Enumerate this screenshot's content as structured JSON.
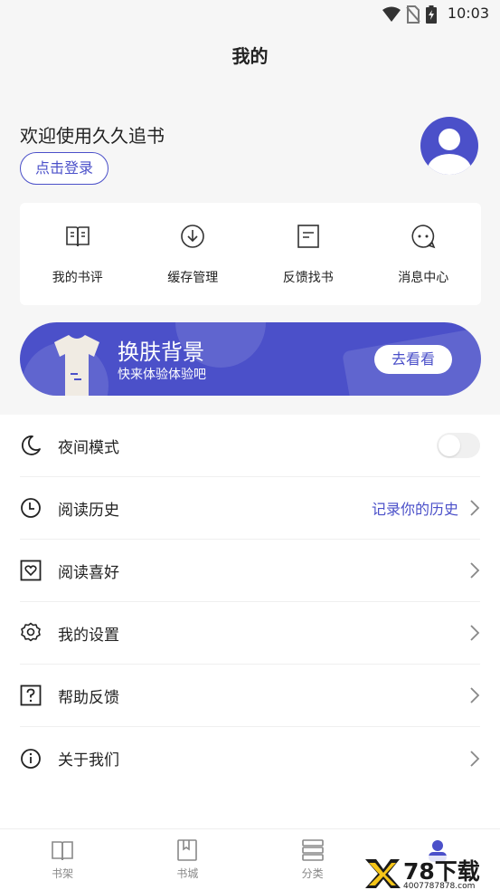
{
  "status": {
    "time": "10:03"
  },
  "header": {
    "title": "我的"
  },
  "profile": {
    "welcome": "欢迎使用久久追书",
    "login_label": "点击登录"
  },
  "quick_actions": [
    {
      "label": "我的书评",
      "icon": "book-review-icon"
    },
    {
      "label": "缓存管理",
      "icon": "download-icon"
    },
    {
      "label": "反馈找书",
      "icon": "feedback-doc-icon"
    },
    {
      "label": "消息中心",
      "icon": "message-icon"
    }
  ],
  "banner": {
    "title": "换肤背景",
    "subtitle": "快来体验体验吧",
    "button": "去看看"
  },
  "menu": [
    {
      "label": "夜间模式",
      "icon": "moon-icon",
      "hint": ""
    },
    {
      "label": "阅读历史",
      "icon": "clock-icon",
      "hint": "记录你的历史"
    },
    {
      "label": "阅读喜好",
      "icon": "heart-icon",
      "hint": ""
    },
    {
      "label": "我的设置",
      "icon": "gear-icon",
      "hint": ""
    },
    {
      "label": "帮助反馈",
      "icon": "question-icon",
      "hint": ""
    },
    {
      "label": "关于我们",
      "icon": "info-icon",
      "hint": ""
    }
  ],
  "tabs": [
    {
      "label": "书架",
      "icon": "bookshelf-icon"
    },
    {
      "label": "书城",
      "icon": "bookstore-icon"
    },
    {
      "label": "分类",
      "icon": "category-icon"
    },
    {
      "label": "",
      "icon": "profile-icon"
    }
  ],
  "watermark": {
    "text": "78下载",
    "url_text": "4007787878.com"
  },
  "colors": {
    "accent": "#4b50c9",
    "background": "#f6f6f6"
  }
}
